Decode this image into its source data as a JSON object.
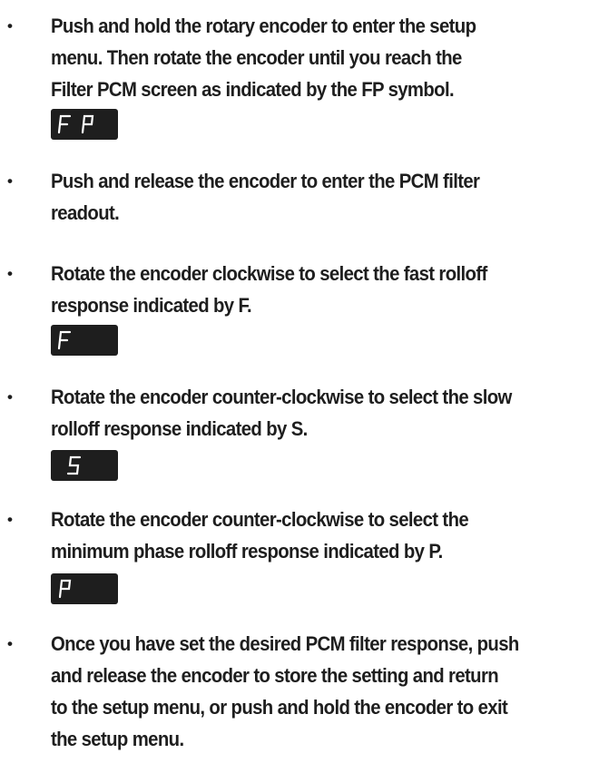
{
  "items": [
    {
      "bullet": "•",
      "lines": [
        "Push and hold the rotary encoder to enter the setup",
        "menu. Then rotate the encoder until you reach the",
        "Filter PCM screen as indicated by the FP symbol."
      ],
      "display": "FP"
    },
    {
      "bullet": "•",
      "lines": [
        "Push and release the encoder to enter the PCM filter",
        "readout."
      ]
    },
    {
      "bullet": "•",
      "lines": [
        "Rotate the encoder clockwise to select the fast rolloff",
        "response indicated by F."
      ],
      "display": "F"
    },
    {
      "bullet": "•",
      "lines": [
        "Rotate the encoder counter-clockwise to select the slow",
        "rolloff response indicated by S."
      ],
      "display": "S"
    },
    {
      "bullet": "•",
      "lines": [
        "Rotate the encoder counter-clockwise to select the",
        "minimum phase rolloff response indicated by P."
      ],
      "display": "P"
    },
    {
      "bullet": "•",
      "lines": [
        "Once you have set the desired PCM filter response, push",
        "and release the encoder to store the setting and return",
        "to the setup menu, or push and hold the encoder to exit",
        "the setup menu."
      ]
    }
  ],
  "colors": {
    "text": "#1e1e1e",
    "display_bg": "#1e1e1e",
    "display_segment": "#ffffff"
  }
}
